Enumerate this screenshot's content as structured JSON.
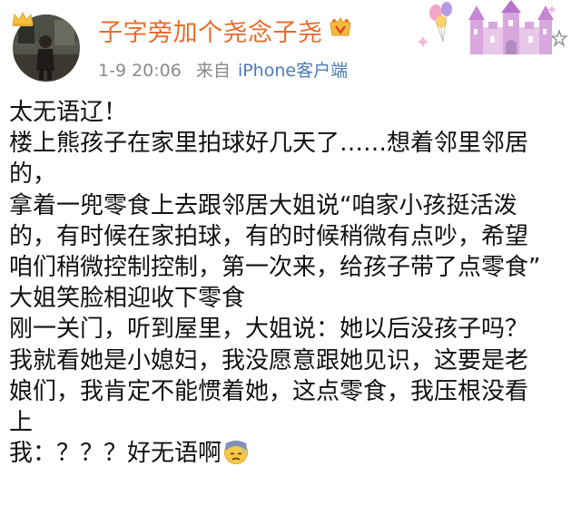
{
  "post": {
    "username": "子字旁加个尧念子尧",
    "time": "1-9 20:06",
    "source_prefix": "来自",
    "device": "iPhone客户端",
    "lines": [
      "太无语辽！",
      "楼上熊孩子在家里拍球好几天了……想着邻里邻居",
      "的，",
      "拿着一兜零食上去跟邻居大姐说“咱家小孩挺活泼",
      "的，有时候在家拍球，有的时候稍微有点吵，希望",
      "咱们稍微控制控制，第一次来，给孩子带了点零食”",
      "大姐笑脸相迎收下零食",
      "刚一关门，听到屋里，大姐说：她以后没孩子吗？",
      "我就看她是小媳妇，我没愿意跟她见识，这要是老",
      "娘们，我肯定不能惯着她，这点零食，我压根没看",
      "上",
      "我：？？？好无语啊"
    ]
  },
  "icons": {
    "avatar_crown": "crown-icon",
    "vip": "vip-badge-icon",
    "decoration": "castle-balloons-decoration",
    "emoji": "sweat-face-emoji"
  },
  "colors": {
    "username": "#ea6b2a",
    "meta": "#8a8a8a",
    "device_link": "#4a7bb7",
    "text": "#111111"
  }
}
